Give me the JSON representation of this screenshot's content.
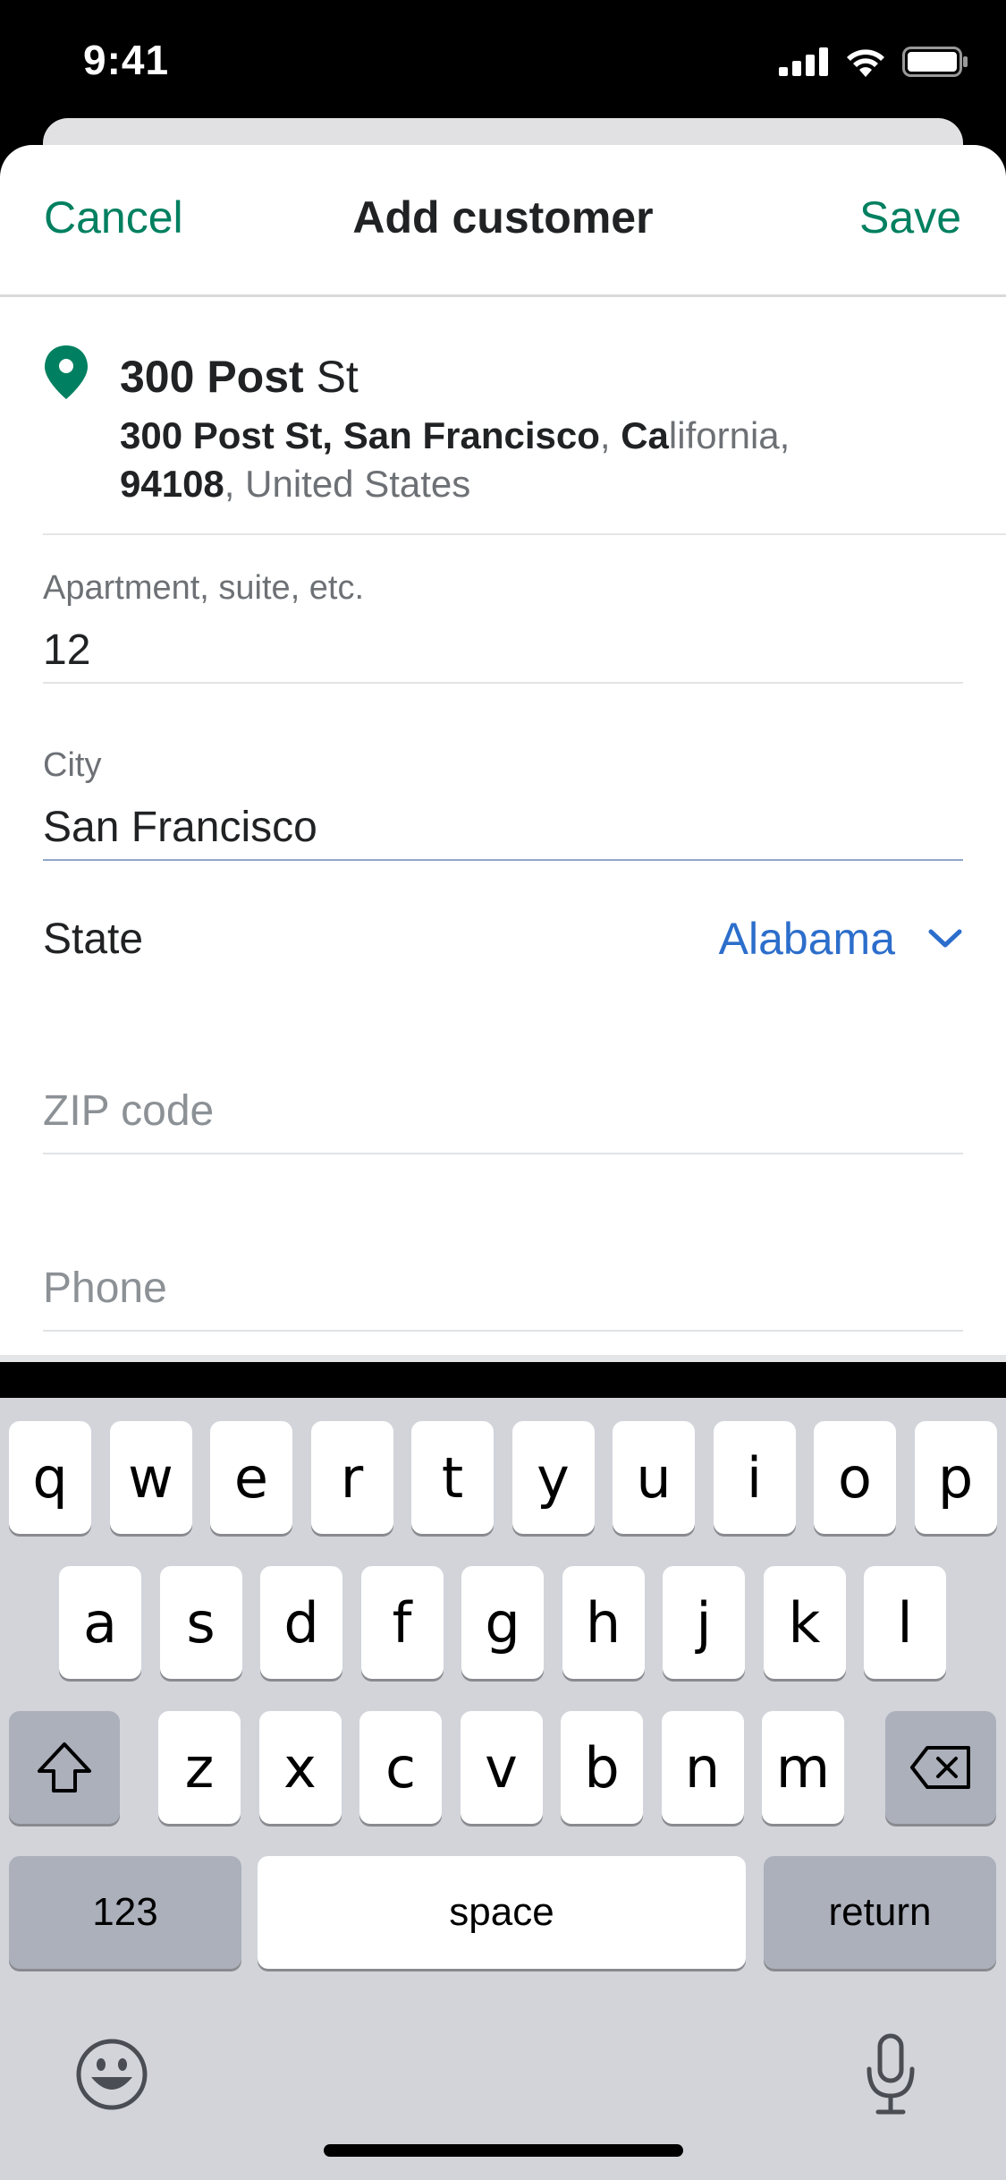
{
  "status_bar": {
    "time": "9:41"
  },
  "nav": {
    "cancel": "Cancel",
    "title": "Add customer",
    "save": "Save"
  },
  "address": {
    "title_bold": "300 Post",
    "title_rest": " St",
    "line_bold_1": "300 Post St, San Francisco",
    "sep_1": ", ",
    "line_bold_2": "Ca",
    "line_muted_1": "lifornia,",
    "line_bold_3": "94108",
    "line_muted_2": ", United States"
  },
  "fields": {
    "apartment": {
      "label": "Apartment, suite, etc.",
      "value": "12"
    },
    "city": {
      "label": "City",
      "value": "San Francisco"
    },
    "state": {
      "label": "State",
      "value": "Alabama"
    },
    "zip": {
      "placeholder": "ZIP code"
    },
    "phone": {
      "placeholder": "Phone"
    }
  },
  "colors": {
    "accent": "#008060",
    "link_blue": "#2c6ecb",
    "keyboard_bg": "#d2d4da"
  },
  "keyboard": {
    "row1": [
      "q",
      "w",
      "e",
      "r",
      "t",
      "y",
      "u",
      "i",
      "o",
      "p"
    ],
    "row2": [
      "a",
      "s",
      "d",
      "f",
      "g",
      "h",
      "j",
      "k",
      "l"
    ],
    "row3": [
      "z",
      "x",
      "c",
      "v",
      "b",
      "n",
      "m"
    ],
    "numbers": "123",
    "space": "space",
    "return": "return",
    "icons": {
      "shift": "shift-icon",
      "delete": "backspace-icon",
      "emoji": "emoji-icon",
      "dictation": "microphone-icon"
    }
  }
}
